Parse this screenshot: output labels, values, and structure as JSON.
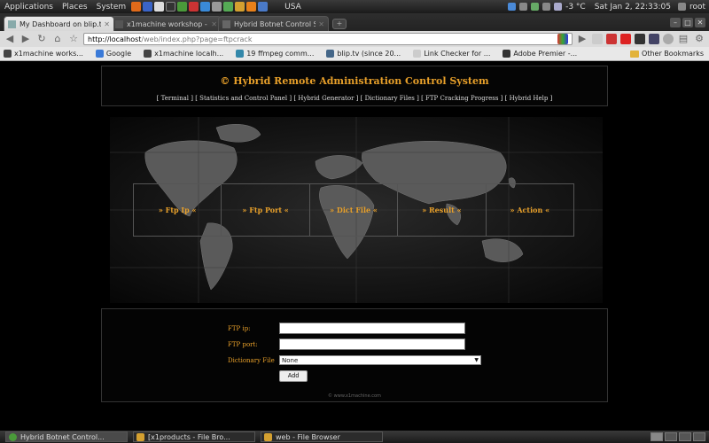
{
  "top_panel": {
    "menus": [
      "Applications",
      "Places",
      "System"
    ],
    "location": "USA",
    "temperature": "-3 °C",
    "clock": "Sat Jan  2, 22:33:05",
    "user": "root"
  },
  "tabs": [
    {
      "title": "My Dashboard on blip.tv ·...",
      "active": true
    },
    {
      "title": "x1machine workshop - re...",
      "active": false
    },
    {
      "title": "Hybrid Botnet Control Sys...",
      "active": false
    }
  ],
  "toolbar": {
    "url_host": "http://localhost",
    "url_path": "/web/index.php?page=ftpcrack"
  },
  "bookmarks": [
    "x1machine works...",
    "Google",
    "x1machine localh...",
    "19 ffmpeg comm...",
    "blip.tv (since 20...",
    "Link Checker for ...",
    "Adobe Premier -..."
  ],
  "other_bookmarks": "Other Bookmarks",
  "site": {
    "title": "© Hybrid Remote Administration Control System",
    "nav": [
      "[ Terminal ]",
      "[ Statistics and Control Panel ]",
      "[ Hybrid Generator ]",
      "[ Dictionary Files ]",
      "[ FTP Cracking Progress ]",
      "[ Hybrid Help ]"
    ],
    "menu": [
      "» Ftp Ip «",
      "» Ftp Port «",
      "» Dict File «",
      "» Result «",
      "» Action «"
    ]
  },
  "form": {
    "ftp_ip_label": "FTP ip:",
    "ftp_ip_value": "",
    "ftp_port_label": "FTP port:",
    "ftp_port_value": "",
    "dict_label": "Dictionary File",
    "dict_selected": "None",
    "add_label": "Add",
    "copyright": "© www.x1machine.com"
  },
  "taskbar": [
    {
      "title": "Hybrid Botnet Control...",
      "active": true
    },
    {
      "title": "[x1products - File Bro...",
      "active": false
    },
    {
      "title": "web - File Browser",
      "active": false
    }
  ],
  "colors": {
    "accent_orange": "#e8a02a",
    "page_bg": "#000000"
  }
}
